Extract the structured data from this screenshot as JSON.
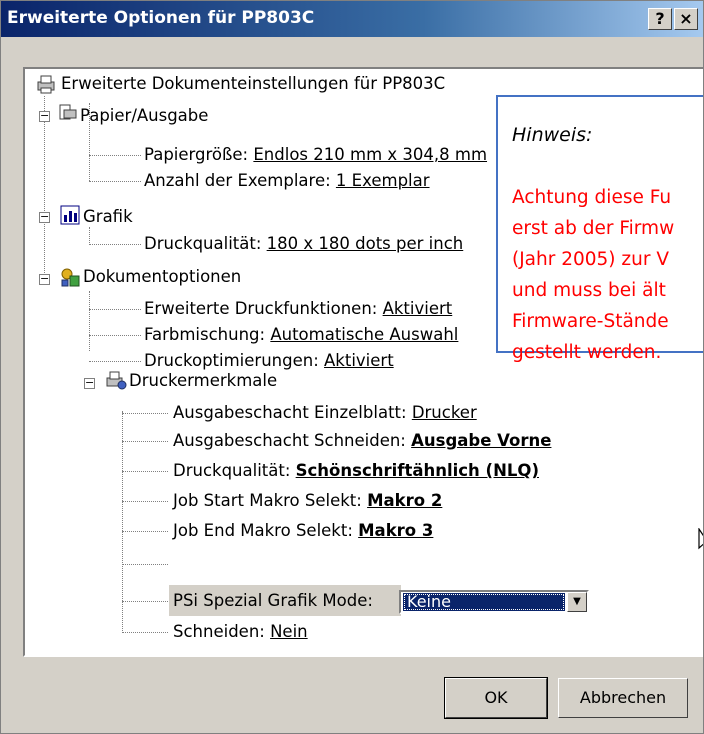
{
  "window": {
    "title": "Erweiterte Optionen für PP803C",
    "help_button": "?",
    "close_button": "×"
  },
  "tree": {
    "root": "Erweiterte Dokumenteinstellungen für PP803C",
    "paper": {
      "label": "Papier/Ausgabe",
      "paper_size_label": "Papiergröße: ",
      "paper_size_value": "Endlos 210 mm x 304,8 mm",
      "copies_label": "Anzahl der Exemplare: ",
      "copies_value": "1 Exemplar"
    },
    "graphics": {
      "label": "Grafik",
      "quality_label": "Druckqualität: ",
      "quality_value": "180 x 180 dots per inch"
    },
    "document_options": {
      "label": "Dokumentoptionen",
      "advanced_label": "Erweiterte Druckfunktionen: ",
      "advanced_value": "Aktiviert",
      "color_label": "Farbmischung: ",
      "color_value": "Automatische Auswahl",
      "optim_label": "Druckoptimierungen: ",
      "optim_value": "Aktiviert"
    },
    "printer_features": {
      "label": "Druckermerkmale",
      "tray_single_label": "Ausgabeschacht Einzelblatt: ",
      "tray_single_value": "Drucker",
      "tray_cut_label": "Ausgabeschacht Schneiden: ",
      "tray_cut_value": "Ausgabe Vorne",
      "quality_label": "Druckqualität: ",
      "quality_value": "Schönschriftähnlich (NLQ)",
      "job_start_label": "Job Start Makro Selekt: ",
      "job_start_value": "Makro 2",
      "job_end_label": "Job End Makro Selekt: ",
      "job_end_value": "Makro 3",
      "psi_label": "PSi Spezial Grafik Mode:",
      "psi_value": "Keine",
      "cut_label": "Schneiden: ",
      "cut_value": "Nein"
    }
  },
  "buttons": {
    "ok": "OK",
    "cancel": "Abbrechen"
  },
  "note": {
    "title": "Hinweis:",
    "lines": [
      "Achtung diese Fu",
      "erst ab der Firmw",
      "(Jahr 2005)  zur V",
      "und muss bei ält",
      "Firmware-Stände",
      "gestellt werden."
    ]
  },
  "colors": {
    "title_bar": "#0a246a",
    "note_border": "#4472c4",
    "note_text": "#ff0000",
    "selection": "#0a246a"
  }
}
